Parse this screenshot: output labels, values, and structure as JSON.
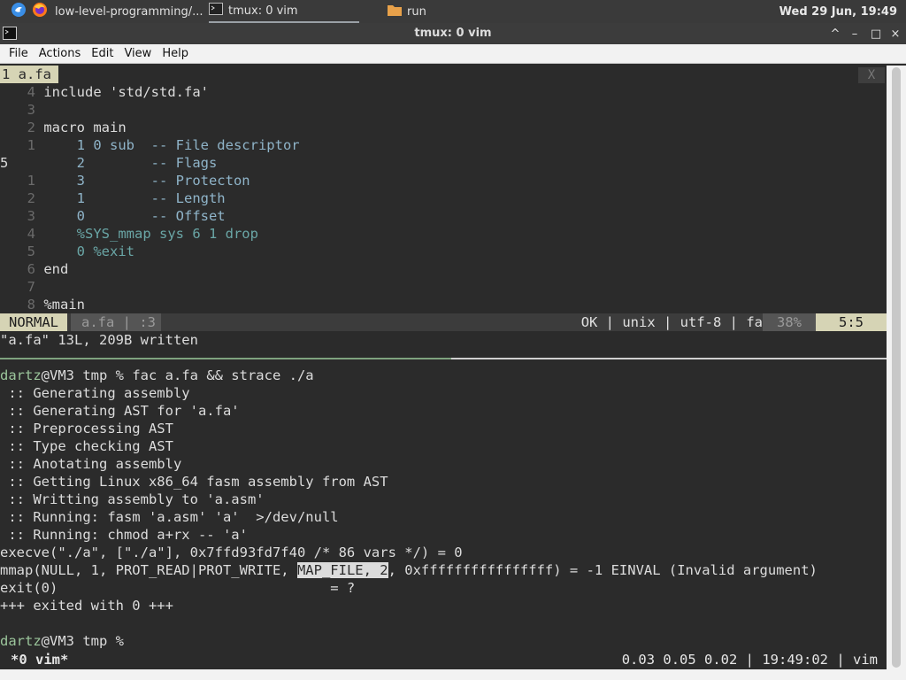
{
  "panel": {
    "items": [
      {
        "label": "",
        "icon": "app-menu-icon"
      },
      {
        "label": "",
        "icon": "firefox-icon"
      },
      {
        "label": "low-level-programming/...",
        "icon": "firefox-icon"
      },
      {
        "label": "tmux: 0 vim",
        "icon": "terminal-icon"
      },
      {
        "label": "run",
        "icon": "folder-icon"
      }
    ],
    "clock": "Wed 29 Jun, 19:49"
  },
  "window": {
    "title": "tmux: 0 vim",
    "controls": [
      "^",
      "–",
      "□",
      "×"
    ]
  },
  "menu": [
    "File",
    "Actions",
    "Edit",
    "View",
    "Help"
  ],
  "vim": {
    "tab_label": "1  a.fa",
    "tab_close": "X",
    "lines": [
      {
        "ln": "4",
        "text": "include 'std/std.fa'"
      },
      {
        "ln": "3",
        "text": ""
      },
      {
        "ln": "2",
        "text": "macro main"
      },
      {
        "ln": "1",
        "text": "1 0 sub  -- File descriptor"
      },
      {
        "ln": "5",
        "text": "2        -- Flags"
      },
      {
        "ln": "1",
        "text": "3        -- Protecton"
      },
      {
        "ln": "2",
        "text": "1        -- Length"
      },
      {
        "ln": "3",
        "text": "0        -- Offset"
      },
      {
        "ln": "4",
        "text": "%SYS_mmap sys 6 1 drop"
      },
      {
        "ln": "5",
        "text": "0 %exit"
      },
      {
        "ln": "6",
        "text": "end"
      },
      {
        "ln": "7",
        "text": ""
      },
      {
        "ln": "8",
        "text": "%main"
      }
    ],
    "status": {
      "mode": "NORMAL",
      "file": "a.fa | :3",
      "right": "OK | unix | utf-8 | fa",
      "percent": "38%",
      "position": "5:5"
    },
    "message": "\"a.fa\" 13L, 209B written"
  },
  "shell": {
    "user": "dartz",
    "host_prompt": "@VM3 tmp % ",
    "command": "fac a.fa && strace ./a",
    "output": [
      " :: Generating assembly",
      " :: Generating AST for 'a.fa'",
      " :: Preprocessing AST",
      " :: Type checking AST",
      " :: Anotating assembly",
      " :: Getting Linux x86_64 fasm assembly from AST",
      " :: Writting assembly to 'a.asm'",
      " :: Running: fasm 'a.asm' 'a'  >/dev/null",
      " :: Running: chmod a+rx -- 'a'",
      "execve(\"./a\", [\"./a\"], 0x7ffd93fd7f40 /* 86 vars */) = 0"
    ],
    "mmap_before": "mmap(NULL, 1, PROT_READ|PROT_WRITE, ",
    "mmap_highlight": "MAP_FILE, 2",
    "mmap_after": ", 0xffffffffffffffff) = -1 EINVAL (Invalid argument)",
    "exit_line": "exit(0)                                 = ?",
    "exited_line": "+++ exited with 0 +++",
    "prompt_user": "dartz",
    "prompt_rest": "@VM3 tmp % "
  },
  "tmux": {
    "left": "*0 vim*",
    "right": "0.03 0.05 0.02 | 19:49:02 | vim"
  }
}
